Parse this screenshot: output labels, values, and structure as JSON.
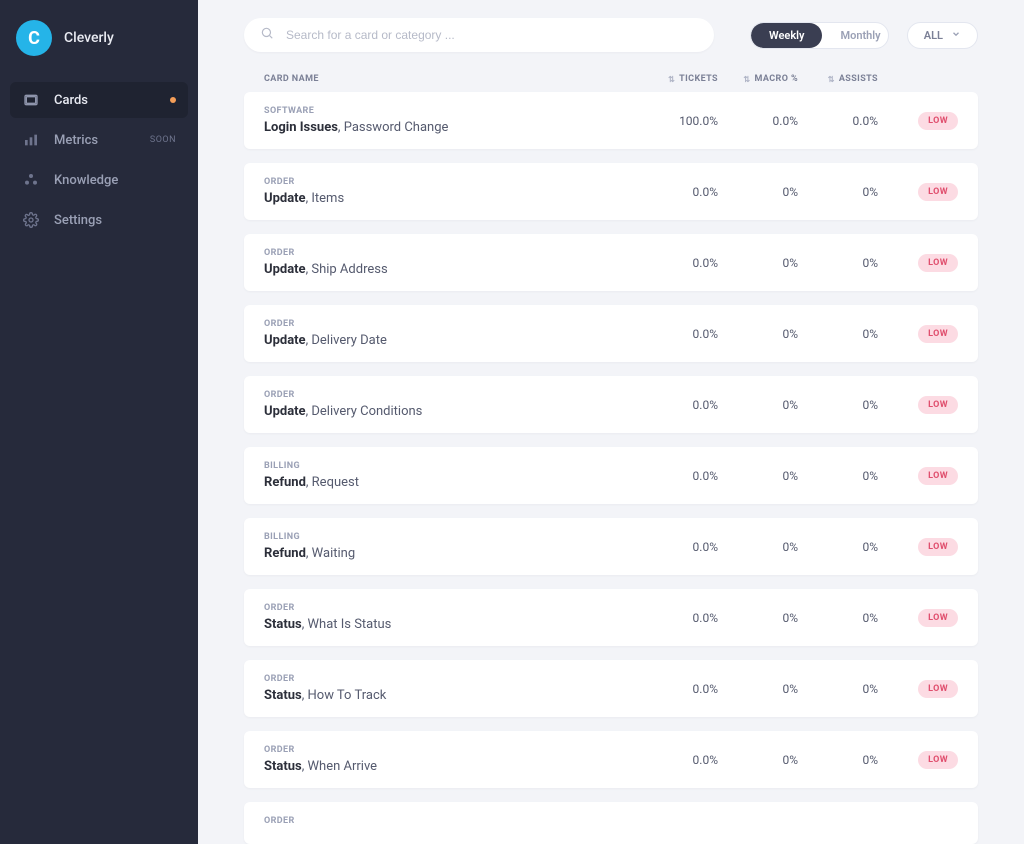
{
  "brand": {
    "initial": "C",
    "name": "Cleverly"
  },
  "sidebar": {
    "items": [
      {
        "label": "Cards",
        "icon": "cards",
        "active": true,
        "dot": true
      },
      {
        "label": "Metrics",
        "icon": "metrics",
        "badge": "SOON"
      },
      {
        "label": "Knowledge",
        "icon": "knowledge"
      },
      {
        "label": "Settings",
        "icon": "settings"
      }
    ]
  },
  "search": {
    "placeholder": "Search for a card or category ..."
  },
  "toggle": {
    "weekly": "Weekly",
    "monthly": "Monthly",
    "active": "weekly"
  },
  "filter": {
    "label": "ALL"
  },
  "columns": {
    "name": "CARD NAME",
    "tickets": "TICKETS",
    "macro": "MACRO %",
    "assists": "ASSISTS"
  },
  "rows": [
    {
      "category": "SOFTWARE",
      "title_bold": "Login Issues",
      "title_rest": ", Password Change",
      "tickets": "100.0%",
      "macro": "0.0%",
      "assists": "0.0%",
      "badge": "LOW"
    },
    {
      "category": "ORDER",
      "title_bold": "Update",
      "title_rest": ", Items",
      "tickets": "0.0%",
      "macro": "0%",
      "assists": "0%",
      "badge": "LOW"
    },
    {
      "category": "ORDER",
      "title_bold": "Update",
      "title_rest": ", Ship Address",
      "tickets": "0.0%",
      "macro": "0%",
      "assists": "0%",
      "badge": "LOW"
    },
    {
      "category": "ORDER",
      "title_bold": "Update",
      "title_rest": ", Delivery Date",
      "tickets": "0.0%",
      "macro": "0%",
      "assists": "0%",
      "badge": "LOW"
    },
    {
      "category": "ORDER",
      "title_bold": "Update",
      "title_rest": ", Delivery Conditions",
      "tickets": "0.0%",
      "macro": "0%",
      "assists": "0%",
      "badge": "LOW"
    },
    {
      "category": "BILLING",
      "title_bold": "Refund",
      "title_rest": ", Request",
      "tickets": "0.0%",
      "macro": "0%",
      "assists": "0%",
      "badge": "LOW"
    },
    {
      "category": "BILLING",
      "title_bold": "Refund",
      "title_rest": ", Waiting",
      "tickets": "0.0%",
      "macro": "0%",
      "assists": "0%",
      "badge": "LOW"
    },
    {
      "category": "ORDER",
      "title_bold": "Status",
      "title_rest": ", What Is Status",
      "tickets": "0.0%",
      "macro": "0%",
      "assists": "0%",
      "badge": "LOW"
    },
    {
      "category": "ORDER",
      "title_bold": "Status",
      "title_rest": ", How To Track",
      "tickets": "0.0%",
      "macro": "0%",
      "assists": "0%",
      "badge": "LOW"
    },
    {
      "category": "ORDER",
      "title_bold": "Status",
      "title_rest": ", When Arrive",
      "tickets": "0.0%",
      "macro": "0%",
      "assists": "0%",
      "badge": "LOW"
    },
    {
      "category": "ORDER",
      "title_bold": "",
      "title_rest": "",
      "tickets": "",
      "macro": "",
      "assists": "",
      "badge": ""
    }
  ]
}
